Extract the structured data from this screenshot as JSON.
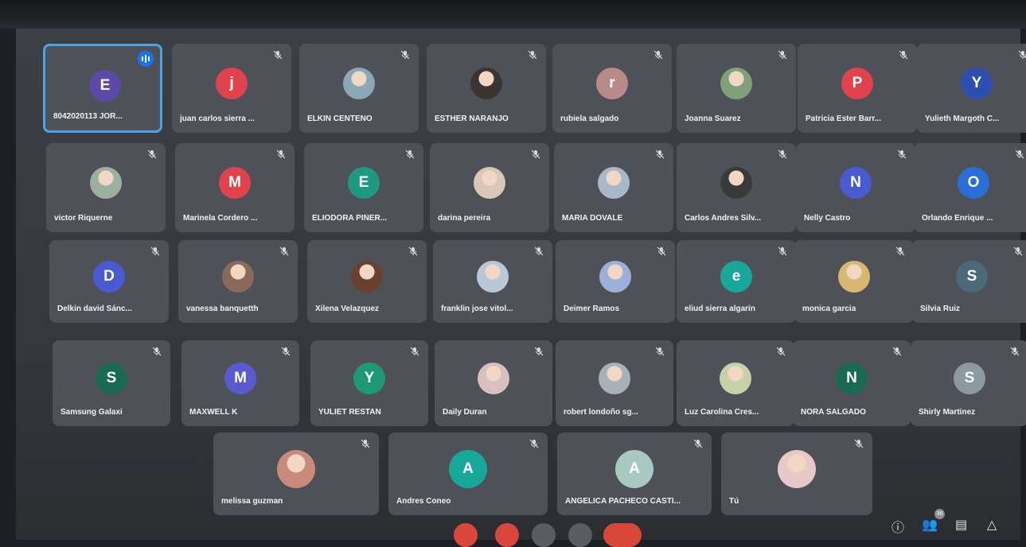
{
  "participants": [
    {
      "name": "8042020113 JOR...",
      "initial": "E",
      "color": "#5b4aa8",
      "active": true
    },
    {
      "name": "juan carlos sierra ...",
      "initial": "j",
      "color": "#e0424e"
    },
    {
      "name": "ELKIN CENTENO",
      "initial": "",
      "color": "#8aa8b8",
      "photo": true
    },
    {
      "name": "ESTHER NARANJO",
      "initial": "",
      "color": "#3b3430",
      "photo": true
    },
    {
      "name": "rubiela salgado",
      "initial": "r",
      "color": "#b98a8a"
    },
    {
      "name": "Joanna Suarez",
      "initial": "",
      "color": "#7fa07a",
      "photo": true
    },
    {
      "name": "Patricia Ester Barr...",
      "initial": "P",
      "color": "#e0424e"
    },
    {
      "name": "Yulieth Margoth C...",
      "initial": "Y",
      "color": "#2f4fb0"
    },
    {
      "name": "victor Riquerne",
      "initial": "",
      "color": "#9cb0a0",
      "photo": true
    },
    {
      "name": "Marinela Cordero ...",
      "initial": "M",
      "color": "#e0424e"
    },
    {
      "name": "ELIODORA PIÑER...",
      "initial": "E",
      "color": "#1e9a82"
    },
    {
      "name": "darina pereira",
      "initial": "",
      "color": "#d8c8b8",
      "photo": true
    },
    {
      "name": "MARIA DOVALE",
      "initial": "",
      "color": "#a8b8c8",
      "photo": true
    },
    {
      "name": "Carlos Andres Silv...",
      "initial": "",
      "color": "#3a3a3a",
      "photo": true
    },
    {
      "name": "Nelly Castro",
      "initial": "N",
      "color": "#4a5ad0"
    },
    {
      "name": "Orlando Enrique ...",
      "initial": "O",
      "color": "#2a6ed8"
    },
    {
      "name": "Delkin david Sánc...",
      "initial": "D",
      "color": "#4a5ad0"
    },
    {
      "name": "vanessa banquetth",
      "initial": "",
      "color": "#8a6a5a",
      "photo": true
    },
    {
      "name": "Xilena Velazquez",
      "initial": "",
      "color": "#6a4030",
      "photo": true
    },
    {
      "name": "franklin jose vitol...",
      "initial": "",
      "color": "#b8c8d8",
      "photo": true
    },
    {
      "name": "Deimer Ramos",
      "initial": "",
      "color": "#9ab0d8",
      "photo": true
    },
    {
      "name": "eliud sierra algarin",
      "initial": "e",
      "color": "#17a89a"
    },
    {
      "name": "monica garcia",
      "initial": "",
      "color": "#d8b870",
      "photo": true
    },
    {
      "name": "Silvia Ruiz",
      "initial": "S",
      "color": "#4a6a7a"
    },
    {
      "name": "Samsung Galaxi",
      "initial": "S",
      "color": "#1a6a52"
    },
    {
      "name": "MAXWELL K",
      "initial": "M",
      "color": "#5a5ad0"
    },
    {
      "name": "YULIET RESTAN",
      "initial": "Y",
      "color": "#1e9a72"
    },
    {
      "name": "Daily Duran",
      "initial": "",
      "color": "#d8c0c0",
      "photo": true
    },
    {
      "name": "robert londoño sg...",
      "initial": "",
      "color": "#a8b0b8",
      "photo": true
    },
    {
      "name": "Luz Carolina Cres...",
      "initial": "",
      "color": "#c8d0a8",
      "photo": true
    },
    {
      "name": "NORA SALGADO",
      "initial": "N",
      "color": "#1a6a52"
    },
    {
      "name": "Shirly Martinez",
      "initial": "S",
      "color": "#8a9aa0"
    },
    {
      "name": "melissa guzman",
      "initial": "",
      "color": "#c88a7a",
      "photo": true
    },
    {
      "name": "Andres Coneo",
      "initial": "A",
      "color": "#17a89a"
    },
    {
      "name": "ANGELICA PACHECO CASTI...",
      "initial": "A",
      "color": "#a8c8c0"
    },
    {
      "name": "Tú",
      "initial": "",
      "color": "#e8c8c8",
      "photo": true
    }
  ],
  "people_count": "36",
  "colors": {
    "speaking": "#1a73e8",
    "active_border": "#4aa3e6",
    "hangup": "#d9473a"
  },
  "icons": {
    "mic_off": "mic-off-icon",
    "speaking": "speaking-indicator-icon",
    "right": [
      "info-icon",
      "people-icon",
      "chat-icon",
      "activities-icon"
    ]
  }
}
